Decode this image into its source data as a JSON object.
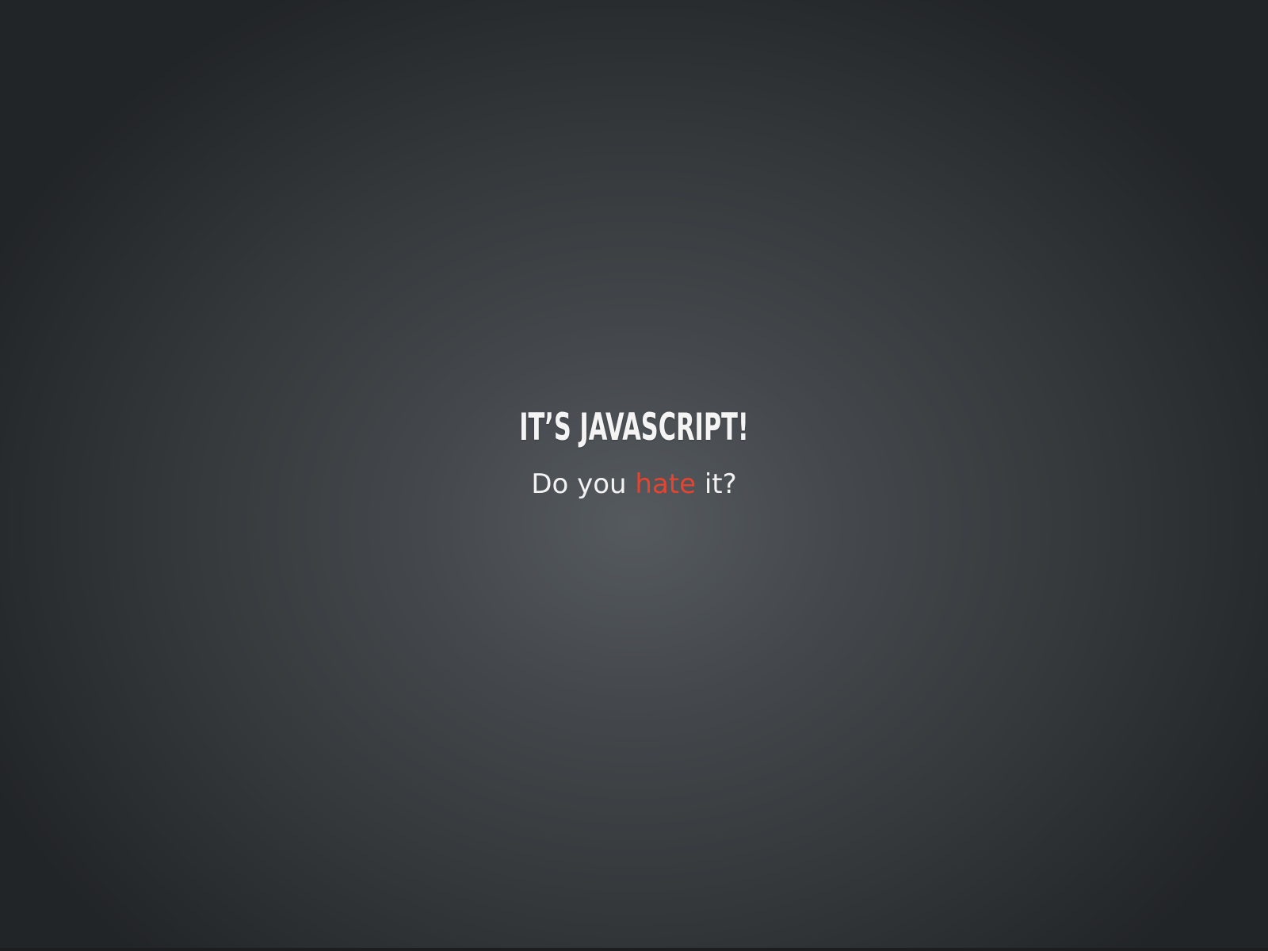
{
  "slide": {
    "heading": "IT’S JAVASCRIPT!",
    "subtitle": {
      "before": "Do you ",
      "emphasis": "hate",
      "after": " it?"
    }
  },
  "colors": {
    "heading_text": "#f4f4f4",
    "body_text": "#f2f2f2",
    "accent": "#e8432f",
    "background_center": "#555a5f",
    "background_edge": "#222527"
  }
}
